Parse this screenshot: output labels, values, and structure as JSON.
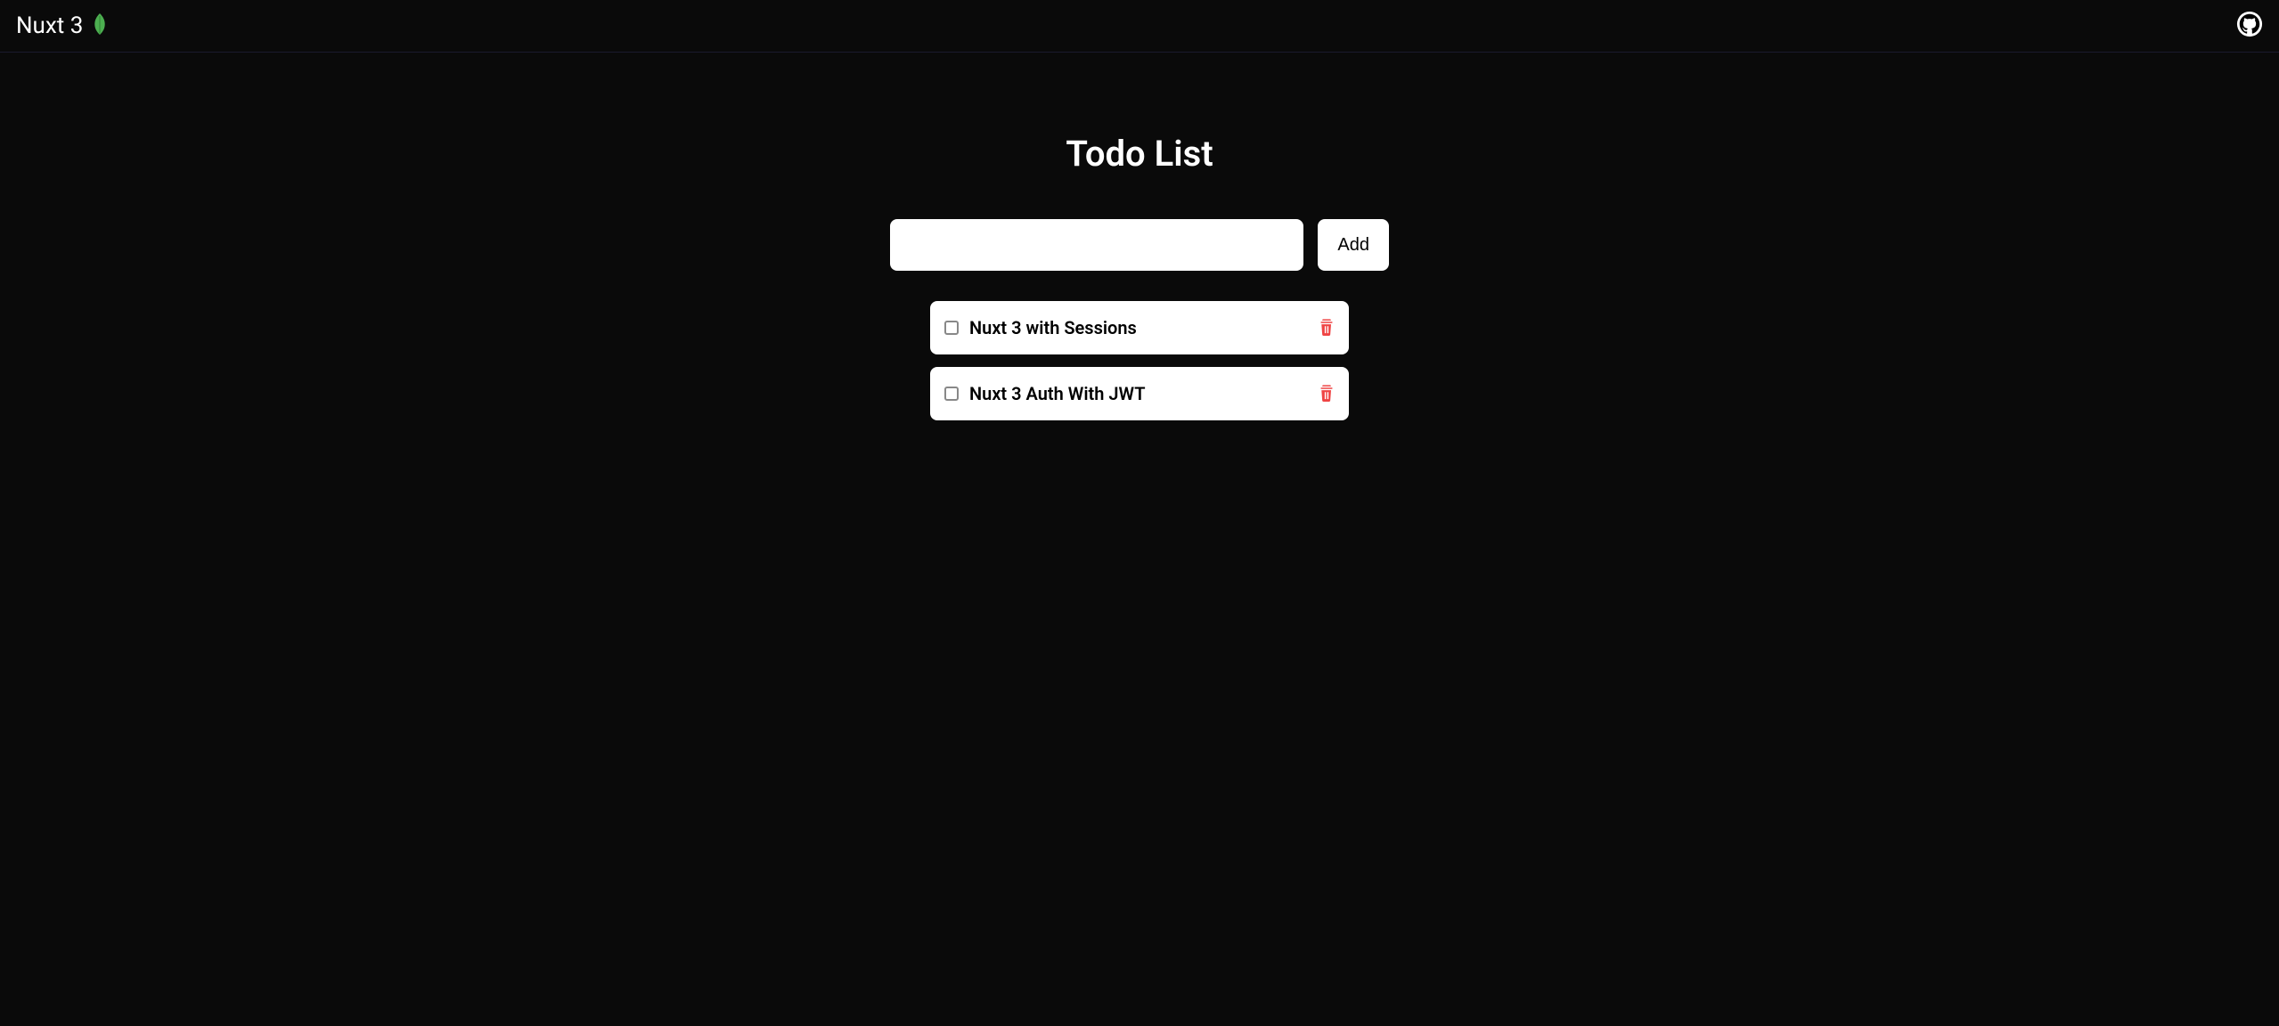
{
  "header": {
    "brand_title": "Nuxt 3"
  },
  "main": {
    "page_title": "Todo List",
    "add_button_label": "Add",
    "new_todo_value": "",
    "new_todo_placeholder": ""
  },
  "todos": [
    {
      "label": "Nuxt 3 with Sessions",
      "checked": false
    },
    {
      "label": "Nuxt 3 Auth With JWT",
      "checked": false
    }
  ],
  "colors": {
    "leaf": "#4caf50",
    "github_bg": "#ffffff",
    "github_fg": "#000000",
    "trash": "#ef4444"
  }
}
